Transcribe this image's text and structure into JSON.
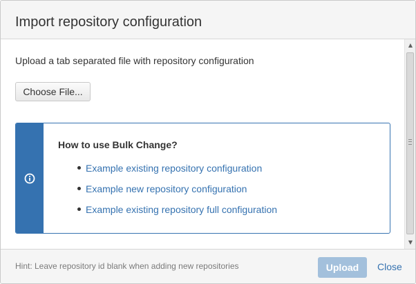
{
  "dialog": {
    "title": "Import repository configuration"
  },
  "body": {
    "instruction": "Upload a tab separated file with repository configuration",
    "choose_file_label": "Choose File..."
  },
  "info_panel": {
    "icon": "info-circle-icon",
    "heading": "How to use Bulk Change?",
    "links": [
      "Example existing repository configuration",
      "Example new repository configuration",
      "Example existing repository full configuration"
    ]
  },
  "footer": {
    "hint": "Hint: Leave repository id blank when adding new repositories",
    "upload_label": "Upload",
    "upload_enabled": false,
    "close_label": "Close"
  },
  "colors": {
    "accent": "#3572b0",
    "upload_disabled": "#a3c0dc",
    "header_bg": "#f5f5f5"
  }
}
